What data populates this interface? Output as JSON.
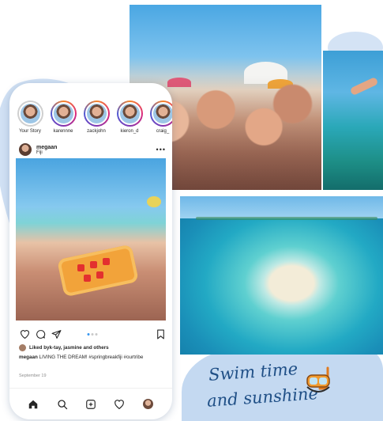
{
  "stories": [
    {
      "label": "Your Story"
    },
    {
      "label": "karennne"
    },
    {
      "label": "zackjohn"
    },
    {
      "label": "kieron_d"
    },
    {
      "label": "craig_"
    }
  ],
  "post": {
    "username": "megaan",
    "location": "Fiji",
    "liked_prefix": "Liked by ",
    "liked_names": "k-tay, jasmine and others",
    "caption_user": "megaan",
    "caption_text": " LIVING THE DREAM! #springbreakfiji  #ourtribe",
    "date": "September 19"
  },
  "headline": {
    "line1": "Swim time",
    "line2": "and sunshine"
  },
  "colors": {
    "accent_blue": "#3897f0",
    "script_navy": "#1f4f86",
    "brush_blue": "#c9dcf2"
  },
  "icons": [
    "heart-icon",
    "comment-icon",
    "share-icon",
    "bookmark-icon",
    "home-icon",
    "search-icon",
    "add-icon",
    "activity-heart-icon",
    "profile-avatar",
    "snorkel-mask-icon"
  ]
}
